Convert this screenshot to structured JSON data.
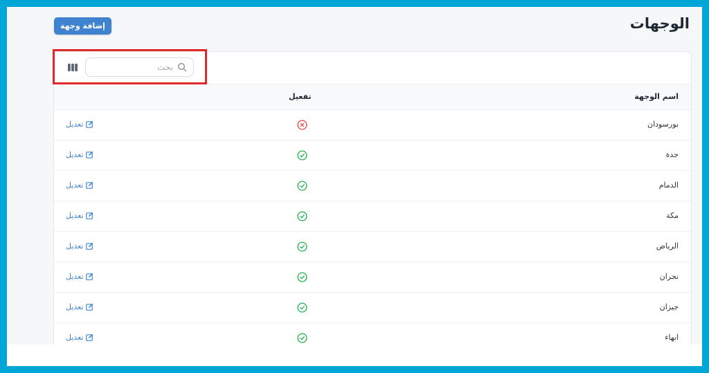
{
  "header": {
    "title": "الوجهات",
    "add_button_label": "إضافة وجهة"
  },
  "toolbar": {
    "search_placeholder": "بحث"
  },
  "table": {
    "columns": {
      "name": "اسم الوجهة",
      "active": "تفعيل"
    },
    "edit_label": "تعديل",
    "rows": [
      {
        "name": "بورسودان",
        "active": false
      },
      {
        "name": "جدة",
        "active": true
      },
      {
        "name": "الدمام",
        "active": true
      },
      {
        "name": "مكة",
        "active": true
      },
      {
        "name": "الرياض",
        "active": true
      },
      {
        "name": "نجران",
        "active": true
      },
      {
        "name": "جيزان",
        "active": true
      },
      {
        "name": "ابهاء",
        "active": true
      }
    ]
  },
  "colors": {
    "primary": "#3f83cf",
    "active": "#22b14c",
    "inactive": "#e04848",
    "frame": "#00a7d6",
    "highlight": "#e02828"
  }
}
